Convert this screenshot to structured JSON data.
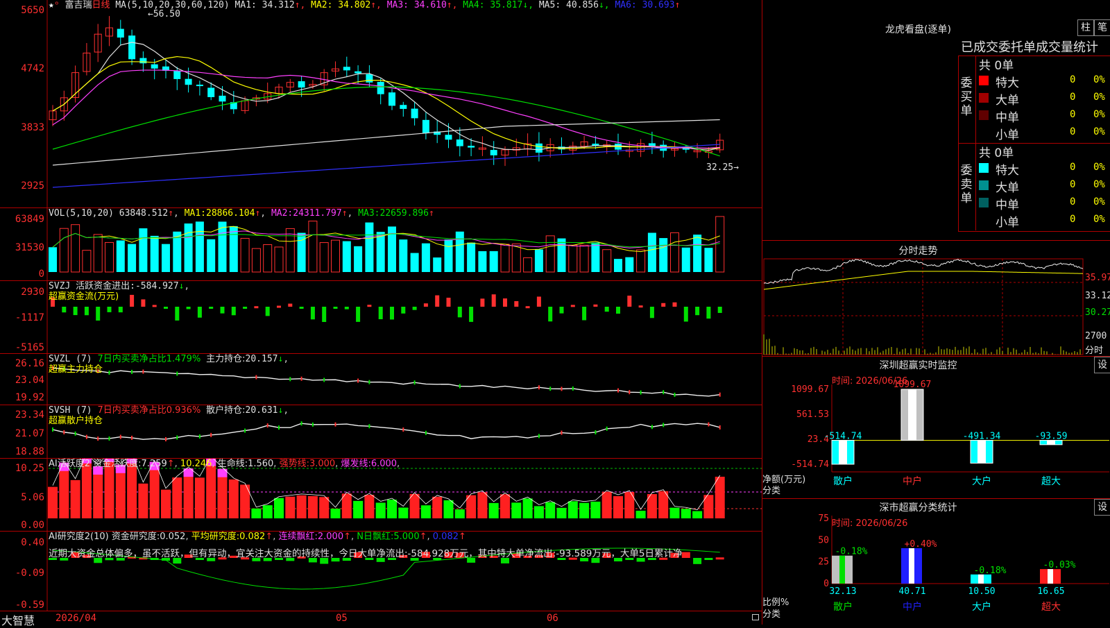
{
  "app": {
    "brand": "大智慧",
    "stock_name": "富吉瑞",
    "period": "日线"
  },
  "kline": {
    "ma_label": "MA(5,10,20,30,60,120)",
    "ma_values": [
      {
        "name": "MA1",
        "value": "34.312",
        "arrow": "↑",
        "color": "#e0e0e0"
      },
      {
        "name": "MA2",
        "value": "34.802",
        "arrow": "↑",
        "color": "#ffff00"
      },
      {
        "name": "MA3",
        "value": "34.610",
        "arrow": "↑",
        "color": "#ff40ff"
      },
      {
        "name": "MA4",
        "value": "35.817",
        "arrow": "↓",
        "color": "#00e000"
      },
      {
        "name": "MA5",
        "value": "40.856",
        "arrow": "↓",
        "color": "#e0e0e0"
      },
      {
        "name": "MA6",
        "value": "30.693",
        "arrow": "↑",
        "color": "#3030ff"
      }
    ],
    "ticks": [
      "5650",
      "4742",
      "3833",
      "2925"
    ],
    "high_label": "56.50",
    "low_label": "32.25"
  },
  "vol": {
    "label": "VOL(5,10,20)",
    "value": "63848.512",
    "ma": [
      {
        "name": "MA1",
        "value": "28866.104",
        "color": "#ffff00"
      },
      {
        "name": "MA2",
        "value": "24311.797",
        "color": "#ff40ff"
      },
      {
        "name": "MA3",
        "value": "22659.896",
        "color": "#00e000"
      }
    ],
    "ticks": [
      "63849",
      "31530",
      "0"
    ]
  },
  "svzj": {
    "name": "SVZJ",
    "label": "活跃资金进出:",
    "value": "-584.927",
    "arrow": "↓",
    "sub": "超赢资金流(万元)",
    "ticks": [
      "2930",
      "-1117",
      "-5165"
    ]
  },
  "svzl": {
    "name": "SVZL",
    "period": "(7)",
    "label1": "7日内买卖净占比1.479%",
    "label2": "主力持仓:",
    "value": "20.157",
    "arrow": "↓",
    "sub": "超赢主力持仓",
    "ticks": [
      "26.16",
      "23.04",
      "19.92"
    ]
  },
  "svsh": {
    "name": "SVSH",
    "period": "(7)",
    "label1": "7日内买卖净占比0.936%",
    "label2": "散户持仓:",
    "value": "20.631",
    "arrow": "↓",
    "sub": "超赢散户持仓",
    "ticks": [
      "23.34",
      "21.07",
      "18.88"
    ]
  },
  "ai1": {
    "name": "AI活跃度2",
    "l1": "资金活跃度:",
    "v1": "7.259",
    "v2": "10.246",
    "l3": "生命线:",
    "v3": "1.560",
    "l4": "强势线:",
    "v4": "3.000",
    "l5": "爆发线:",
    "v5": "6.000",
    "ticks": [
      "10.25",
      "5.06",
      "0.00"
    ]
  },
  "ai2": {
    "name": "AI研究度2(10)",
    "l1": "资金研究度:",
    "v1": "0.052",
    "l2": "平均研究度:",
    "v2": "0.082",
    "l3": "连续飘红:",
    "v3": "2.000",
    "l4": "N日飘红:",
    "v4": "5.000",
    "v5": "0.082",
    "text": "近期大资金总体偏多，虽不活跃，但有异动，宜关注大资金的持续性，今日大单净流出:-584.928万元，其中特大单净流出:-93.589万元，大单5日累计净",
    "ticks": [
      "0.40",
      "-0.09",
      "-0.59"
    ]
  },
  "xaxis": {
    "labels": [
      "2026/04",
      "05",
      "06"
    ]
  },
  "lhb": {
    "title": "龙虎看盘(逐单)",
    "btn1": "柱",
    "btn2": "笔",
    "subtitle": "已成交委托单成交量统计",
    "buy": {
      "side": "委买单",
      "total": "共 0单",
      "rows": [
        {
          "label": "特大",
          "count": "0",
          "pct": "0%",
          "color": "#ff0000"
        },
        {
          "label": "大单",
          "count": "0",
          "pct": "0%",
          "color": "#a00000"
        },
        {
          "label": "中单",
          "count": "0",
          "pct": "0%",
          "color": "#600000"
        },
        {
          "label": "小单",
          "count": "0",
          "pct": "0%",
          "color": "#000000"
        }
      ]
    },
    "sell": {
      "side": "委卖单",
      "total": "共 0单",
      "rows": [
        {
          "label": "特大",
          "count": "0",
          "pct": "0%",
          "color": "#00ffff"
        },
        {
          "label": "大单",
          "count": "0",
          "pct": "0%",
          "color": "#009090"
        },
        {
          "label": "中单",
          "count": "0",
          "pct": "0%",
          "color": "#006060"
        },
        {
          "label": "小单",
          "count": "0",
          "pct": "0%",
          "color": "#000000"
        }
      ]
    }
  },
  "intraday": {
    "title": "分时走势",
    "ticks": [
      "35.97",
      "33.12",
      "30.27",
      "2700",
      "分时"
    ]
  },
  "sz_monitor": {
    "title": "深圳超赢实时监控",
    "btn": "设",
    "date": "时间: 2026/06/26",
    "ticks": [
      "1099.67",
      "561.53",
      "23.4",
      "-514.74"
    ],
    "ylabel": "净额(万元)",
    "xlabel": "分类",
    "bars": [
      {
        "name": "散户",
        "value": "-514.74"
      },
      {
        "name": "中户",
        "value": "1099.67"
      },
      {
        "name": "大户",
        "value": "-491.34"
      },
      {
        "name": "超大",
        "value": "-93.59"
      }
    ]
  },
  "sz_class": {
    "title": "深市超赢分类统计",
    "btn": "设",
    "date": "时间: 2026/06/26",
    "ticks": [
      "75",
      "50",
      "25",
      "0"
    ],
    "ylabel": "比例%",
    "xlabel": "分类",
    "bars": [
      {
        "name": "散户",
        "value": "32.13",
        "chg": "-0.18%"
      },
      {
        "name": "中户",
        "value": "40.71",
        "chg": "+0.40%"
      },
      {
        "name": "大户",
        "value": "10.50",
        "chg": "-0.18%"
      },
      {
        "name": "超大",
        "value": "16.65",
        "chg": "-0.03%"
      }
    ]
  }
}
